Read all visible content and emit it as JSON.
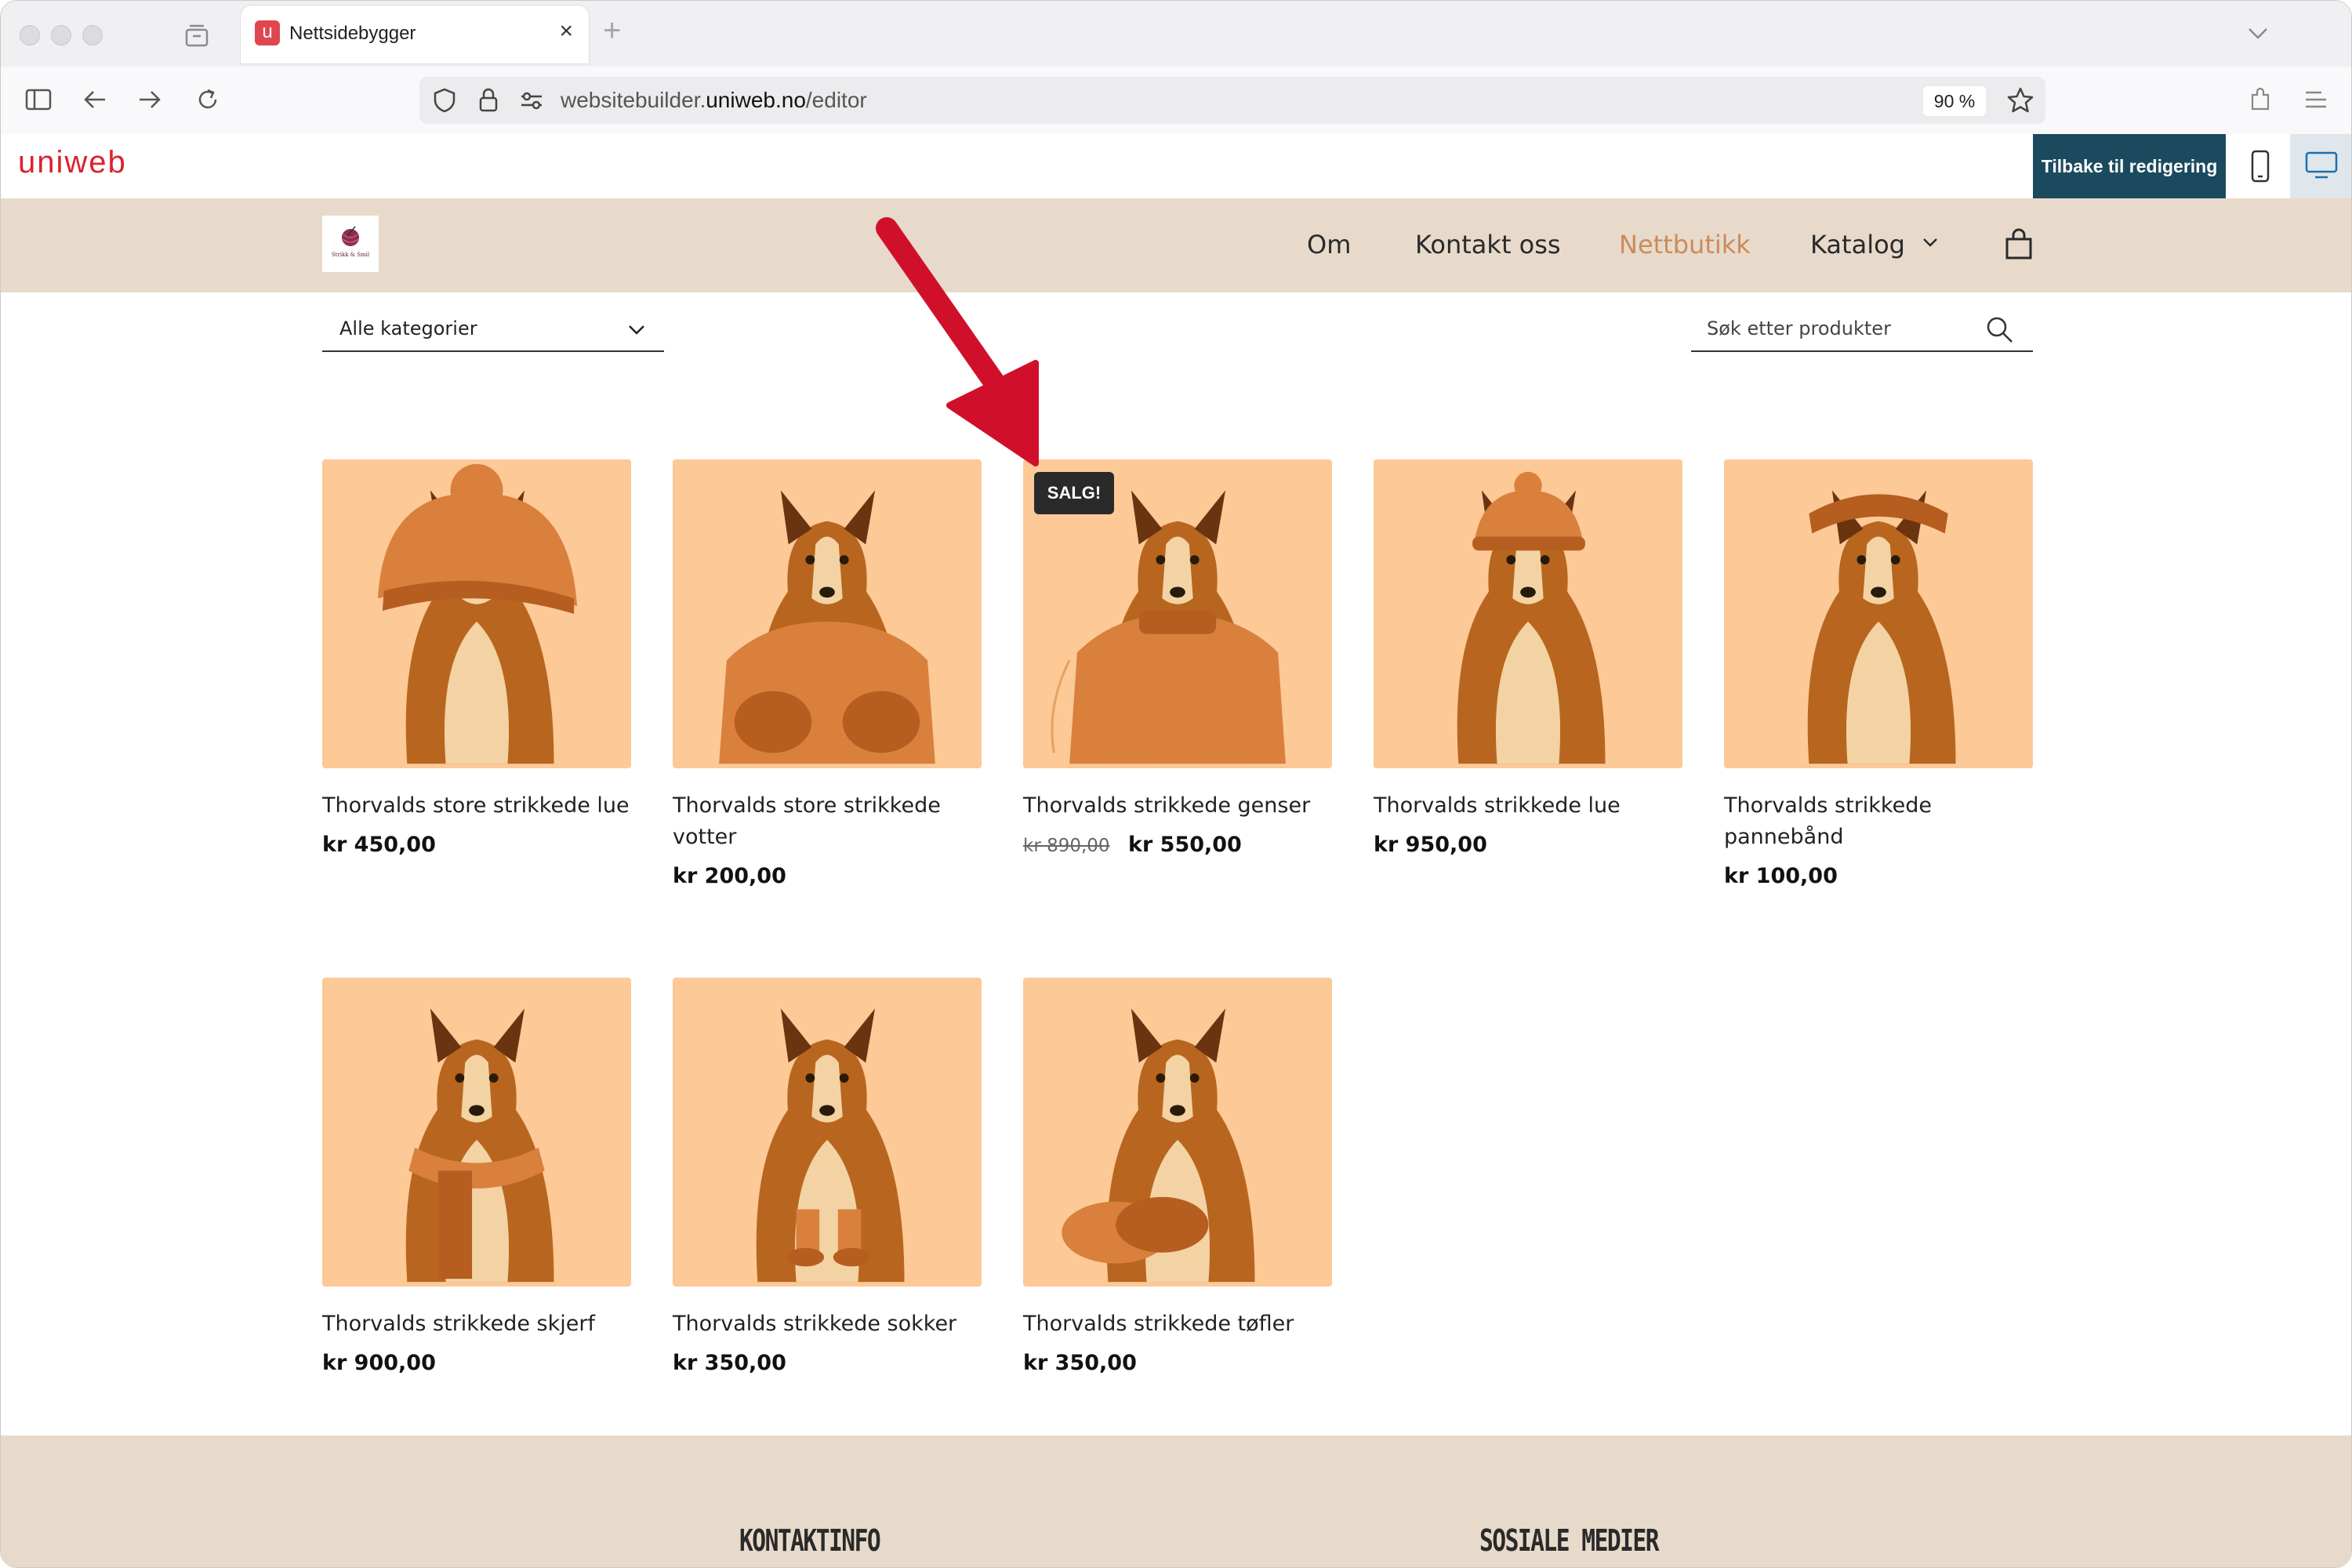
{
  "browser": {
    "tab_title": "Nettsidebygger",
    "tab_favicon_letter": "u",
    "tab_close": "×",
    "new_tab": "+",
    "url_prefix": "websitebuilder.",
    "url_domain": "uniweb.no",
    "url_path": "/editor",
    "zoom": "90 %"
  },
  "editor": {
    "logo": "uniweb",
    "back_button": "Tilbake til redigering"
  },
  "site": {
    "logo_text": "Strikk & Smil",
    "menu": [
      {
        "label": "Om"
      },
      {
        "label": "Kontakt oss"
      },
      {
        "label": "Nettbutikk"
      },
      {
        "label": "Katalog"
      }
    ],
    "active_menu": "Nettbutikk"
  },
  "shop": {
    "category_filter": "Alle kategorier",
    "search_placeholder": "Søk etter produkter",
    "sale_badge": "SALG!",
    "products": [
      {
        "name": "Thorvalds store strikkede lue",
        "price": "kr 450,00",
        "item": "hat-big"
      },
      {
        "name": "Thorvalds store strikkede votter",
        "price": "kr 200,00",
        "item": "mittens"
      },
      {
        "name": "Thorvalds strikkede genser",
        "old_price": "kr 890,00",
        "price": "kr 550,00",
        "item": "sweater"
      },
      {
        "name": "Thorvalds strikkede lue",
        "price": "kr 950,00",
        "item": "hat"
      },
      {
        "name": "Thorvalds strikkede pannebånd",
        "price": "kr 100,00",
        "item": "headband"
      },
      {
        "name": "Thorvalds strikkede skjerf",
        "price": "kr 900,00",
        "item": "scarf"
      },
      {
        "name": "Thorvalds strikkede sokker",
        "price": "kr 350,00",
        "item": "socks"
      },
      {
        "name": "Thorvalds strikkede tøfler",
        "price": "kr 350,00",
        "item": "slippers"
      }
    ]
  },
  "footer": {
    "contact_heading": "KONTAKTINFO",
    "social_heading": "SOSIALE MEDIER"
  },
  "colors": {
    "header_bg": "#e8dacb",
    "accent": "#c98c5b",
    "product_bg": "#fcc997",
    "editor_button": "#1b4a5f",
    "arrow": "#d0102a"
  }
}
